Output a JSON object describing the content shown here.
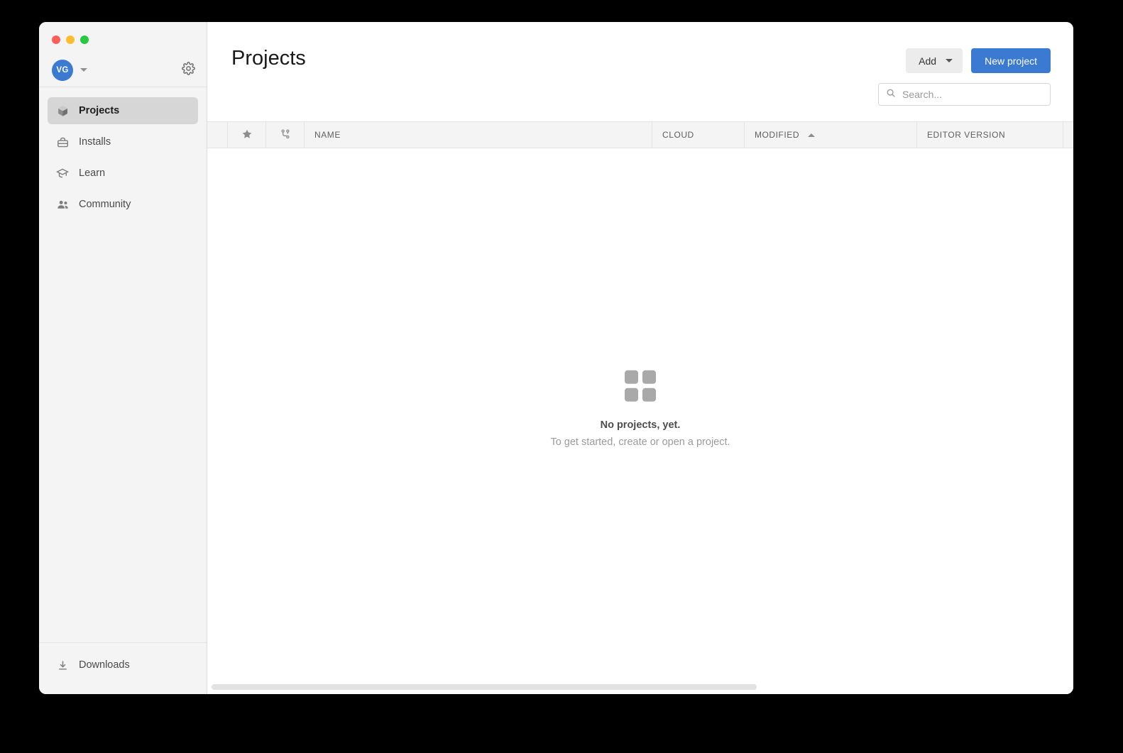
{
  "window": {
    "traffic_lights": [
      "close",
      "minimize",
      "maximize"
    ]
  },
  "sidebar": {
    "account": {
      "avatar_initials": "VG",
      "avatar_color": "#3b7ad1",
      "dropdown_icon": "chevron-down-icon",
      "settings_icon": "gear-icon"
    },
    "items": [
      {
        "label": "Projects",
        "icon": "cube-icon",
        "active": true
      },
      {
        "label": "Installs",
        "icon": "toolbox-icon",
        "active": false
      },
      {
        "label": "Learn",
        "icon": "graduation-cap-icon",
        "active": false
      },
      {
        "label": "Community",
        "icon": "people-icon",
        "active": false
      }
    ],
    "bottom": {
      "label": "Downloads",
      "icon": "download-icon"
    }
  },
  "header": {
    "title": "Projects",
    "add_button": "Add",
    "add_button_icon": "chevron-down-icon",
    "new_project_button": "New project",
    "primary_color": "#3b7ad1"
  },
  "search": {
    "placeholder": "Search...",
    "value": "",
    "icon": "search-icon"
  },
  "table": {
    "columns": [
      {
        "key": "favorite",
        "label": "",
        "icon": "star-icon"
      },
      {
        "key": "vcs",
        "label": "",
        "icon": "version-control-icon"
      },
      {
        "key": "name",
        "label": "NAME",
        "icon": ""
      },
      {
        "key": "cloud",
        "label": "CLOUD",
        "icon": ""
      },
      {
        "key": "modified",
        "label": "MODIFIED",
        "icon": "sort-asc-icon"
      },
      {
        "key": "editor",
        "label": "EDITOR VERSION",
        "icon": ""
      }
    ],
    "sorted_by": "MODIFIED",
    "sort_direction": "asc",
    "rows": []
  },
  "empty_state": {
    "icon": "grid-2x2-icon",
    "title": "No projects, yet.",
    "subtitle": "To get started, create or open a project."
  },
  "scrollbar": {
    "orientation": "horizontal"
  }
}
